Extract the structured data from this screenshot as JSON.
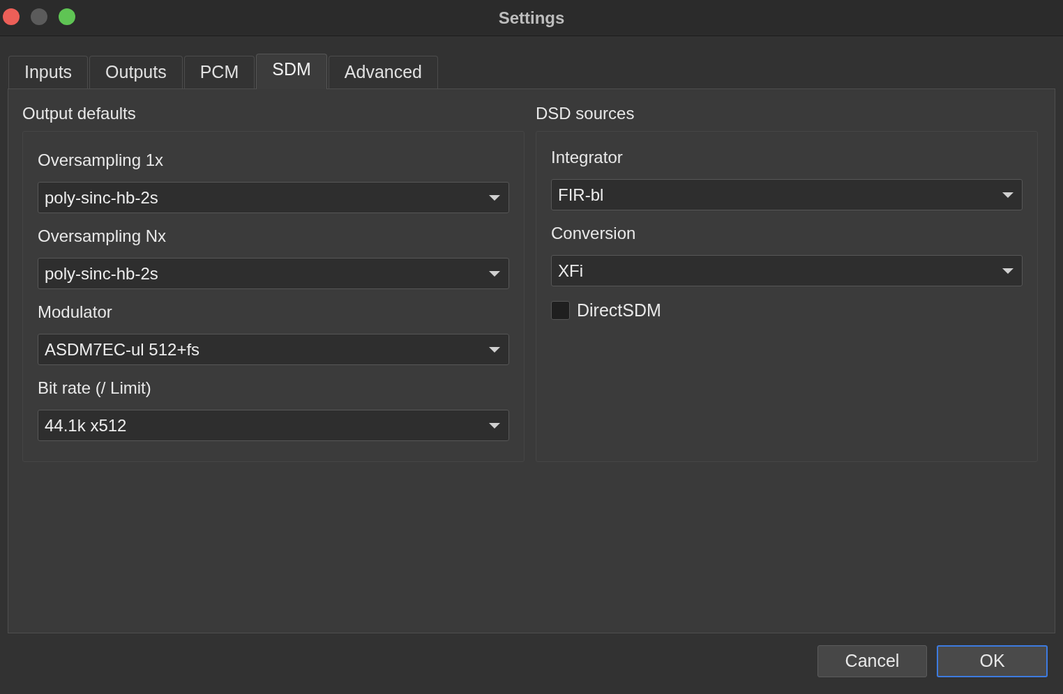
{
  "window": {
    "title": "Settings"
  },
  "tabs": [
    {
      "label": "Inputs",
      "selected": false
    },
    {
      "label": "Outputs",
      "selected": false
    },
    {
      "label": "PCM",
      "selected": false
    },
    {
      "label": "SDM",
      "selected": true
    },
    {
      "label": "Advanced",
      "selected": false
    }
  ],
  "output_defaults": {
    "title": "Output defaults",
    "fields": [
      {
        "label": "Oversampling 1x",
        "value": "poly-sinc-hb-2s"
      },
      {
        "label": "Oversampling Nx",
        "value": "poly-sinc-hb-2s"
      },
      {
        "label": "Modulator",
        "value": "ASDM7EC-ul 512+fs"
      },
      {
        "label": "Bit rate (/ Limit)",
        "value": "44.1k x512"
      }
    ]
  },
  "dsd_sources": {
    "title": "DSD sources",
    "fields": [
      {
        "label": "Integrator",
        "value": "FIR-bl"
      },
      {
        "label": "Conversion",
        "value": "XFi"
      }
    ],
    "checkbox": {
      "label": "DirectSDM",
      "checked": false
    }
  },
  "buttons": [
    {
      "label": "Cancel",
      "default": false
    },
    {
      "label": "OK",
      "default": true
    }
  ]
}
